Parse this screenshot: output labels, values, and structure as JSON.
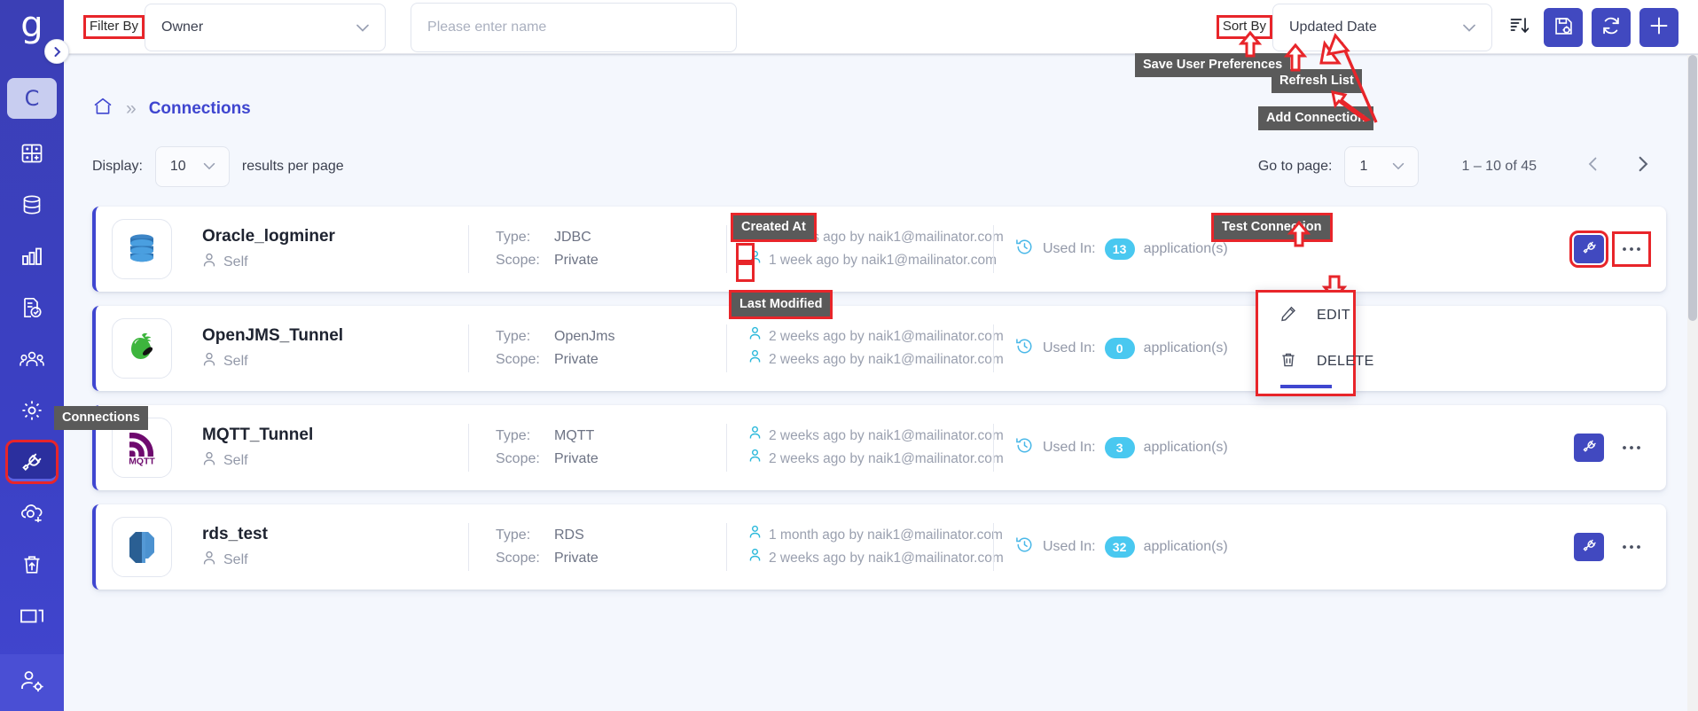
{
  "brand": {
    "logo_letter": "g",
    "accent": "#3f46d0",
    "accent_button": "#4149c0",
    "badge_color": "#49c8f0",
    "highlight": "#e8252a"
  },
  "topbar": {
    "filter_label": "Filter By",
    "filter_value": "Owner",
    "search_placeholder": "Please enter name",
    "search_value": "",
    "sort_label": "Sort By",
    "sort_value": "Updated Date",
    "sort_direction_icon": "sort-descending-icon",
    "save_prefs_icon": "save-settings-icon",
    "refresh_icon": "refresh-icon",
    "add_icon": "plus-icon"
  },
  "tooltips": {
    "save_user_preferences": "Save User Preferences",
    "refresh_list": "Refresh List",
    "add_connection": "Add Connection",
    "created_at": "Created At",
    "last_modified": "Last Modified",
    "test_connection": "Test Connection",
    "connections_nav": "Connections"
  },
  "breadcrumb": {
    "home_icon": "home-icon",
    "separator": "»",
    "current": "Connections"
  },
  "list_controls": {
    "display_label": "Display:",
    "page_size": "10",
    "display_suffix": "results per page",
    "goto_label": "Go to page:",
    "current_page": "1",
    "range_text": "1 – 10 of 45",
    "prev_icon": "chevron-left-icon",
    "next_icon": "chevron-right-icon"
  },
  "card_labels": {
    "type": "Type:",
    "scope": "Scope:",
    "used_in": "Used In:",
    "used_in_suffix": "application(s)",
    "owner_icon": "person-icon",
    "clock_icon": "history-clock-icon",
    "test_icon": "plug-icon",
    "more_icon": "ellipsis-icon"
  },
  "context_menu": {
    "items": [
      {
        "label": "EDIT",
        "icon": "pencil-icon"
      },
      {
        "label": "DELETE",
        "icon": "trash-icon"
      }
    ]
  },
  "sidebar": {
    "items": [
      {
        "name": "sidebar-item-home-letter",
        "icon": "letter-c-icon",
        "label": "C"
      },
      {
        "name": "sidebar-item-dashboard",
        "icon": "dashboard-grid-icon",
        "label": ""
      },
      {
        "name": "sidebar-item-database",
        "icon": "database-icon",
        "label": ""
      },
      {
        "name": "sidebar-item-analytics",
        "icon": "bar-chart-icon",
        "label": ""
      },
      {
        "name": "sidebar-item-reports",
        "icon": "document-check-icon",
        "label": ""
      },
      {
        "name": "sidebar-item-users",
        "icon": "people-group-icon",
        "label": ""
      },
      {
        "name": "sidebar-item-settings",
        "icon": "gear-icon",
        "label": ""
      },
      {
        "name": "sidebar-item-connections",
        "icon": "plug-icon",
        "label": ""
      },
      {
        "name": "sidebar-item-deploy",
        "icon": "cloud-upload-icon",
        "label": ""
      },
      {
        "name": "sidebar-item-recycle",
        "icon": "trash-upload-icon",
        "label": ""
      },
      {
        "name": "sidebar-item-screens",
        "icon": "window-icon",
        "label": ""
      }
    ],
    "bottom_item": {
      "name": "sidebar-item-account-settings",
      "icon": "user-gear-icon"
    }
  },
  "connections": [
    {
      "name": "Oracle_logminer",
      "owner": "Self",
      "type": "JDBC",
      "scope": "Private",
      "created": "3 weeks ago by naik1@mailinator.com",
      "modified": "1 week ago by naik1@mailinator.com",
      "used_in": "13",
      "icon": "oracle-database-icon"
    },
    {
      "name": "OpenJMS_Tunnel",
      "owner": "Self",
      "type": "OpenJms",
      "scope": "Private",
      "created": "2 weeks ago by naik1@mailinator.com",
      "modified": "2 weeks ago by naik1@mailinator.com",
      "used_in": "0",
      "icon": "openjms-pepper-icon"
    },
    {
      "name": "MQTT_Tunnel",
      "owner": "Self",
      "type": "MQTT",
      "scope": "Private",
      "created": "2 weeks ago by naik1@mailinator.com",
      "modified": "2 weeks ago by naik1@mailinator.com",
      "used_in": "3",
      "icon": "mqtt-icon"
    },
    {
      "name": "rds_test",
      "owner": "Self",
      "type": "RDS",
      "scope": "Private",
      "created": "1 month ago by naik1@mailinator.com",
      "modified": "2 weeks ago by naik1@mailinator.com",
      "used_in": "32",
      "icon": "aws-rds-icon"
    }
  ]
}
